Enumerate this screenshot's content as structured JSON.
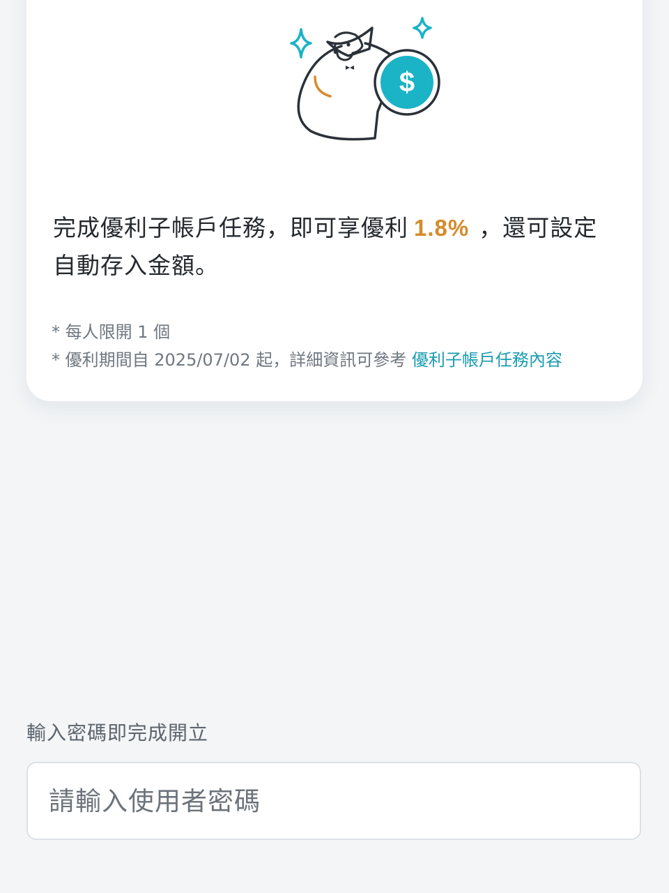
{
  "promo": {
    "illustration": "money-bag-with-dollar-coin-icon",
    "text_before": "完成優利子帳戶任務，即可享優利",
    "rate": "1.8%",
    "text_after": "，還可設定自動存入金額。",
    "note_1": "* 每人限開 1 個",
    "note_2_prefix": "* 優利期間自 2025/07/02 起，詳細資訊可參考",
    "note_2_link": "優利子帳戶任務內容"
  },
  "password": {
    "label": "輸入密碼即完成開立",
    "placeholder": "請輸入使用者密碼",
    "value": ""
  },
  "colors": {
    "accent_orange": "#d68a2b",
    "accent_teal": "#1a9cb0",
    "coin_teal": "#1bb3c6"
  }
}
